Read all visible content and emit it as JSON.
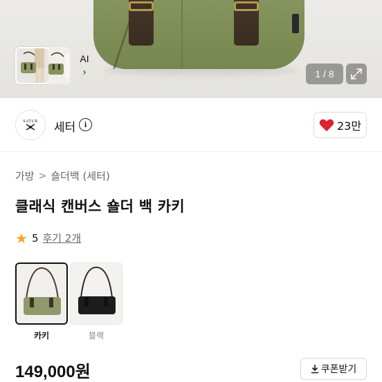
{
  "gallery": {
    "counter": "1 / 8",
    "ai_label": "AI",
    "ai_arrow": "›"
  },
  "shop": {
    "avatar_text": "SATUR",
    "name": "세터",
    "like_count": "23만"
  },
  "product": {
    "breadcrumb": [
      "가방",
      "숄더백 (세터)"
    ],
    "breadcrumb_sep": ">",
    "title": "클래식 캔버스 숄더 백 카키",
    "rating": "5",
    "reviews": "후기 2개",
    "price": "149,000원",
    "coupon": "쿠폰받기"
  },
  "options": [
    {
      "label": "카키",
      "selected": true,
      "color": "#8f9a6a"
    },
    {
      "label": "블랙",
      "selected": false,
      "color": "#1d1d1d"
    }
  ],
  "colors": {
    "heart": "#e0212f",
    "star": "#f5a623",
    "bag_khaki": "#84925c",
    "strap": "#3f3226"
  }
}
